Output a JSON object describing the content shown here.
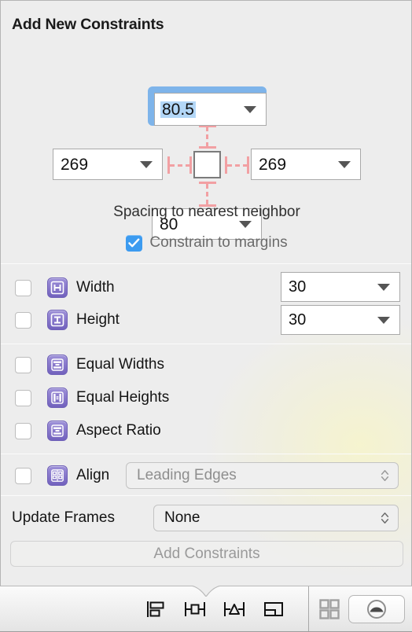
{
  "popover": {
    "title": "Add New Constraints",
    "spacing": {
      "top_value": "80.5",
      "left_value": "269",
      "right_value": "269",
      "bottom_value": "80",
      "caption": "Spacing to nearest neighbor",
      "constrain_margins_label": "Constrain to margins",
      "constrain_margins_checked": true,
      "connector_color": "#f2a0a3",
      "focus_ring_color": "#7eb4ea",
      "selection_color": "#b3d7f7"
    },
    "size_rows": [
      {
        "icon": "width-beam-icon",
        "label": "Width",
        "checked": false,
        "value": "30"
      },
      {
        "icon": "height-beam-icon",
        "label": "Height",
        "checked": false,
        "value": "30"
      }
    ],
    "relation_rows": [
      {
        "icon": "equal-widths-icon",
        "label": "Equal Widths",
        "checked": false
      },
      {
        "icon": "equal-heights-icon",
        "label": "Equal Heights",
        "checked": false
      },
      {
        "icon": "aspect-ratio-icon",
        "label": "Aspect Ratio",
        "checked": false
      }
    ],
    "align_row": {
      "icon": "align-icon",
      "label": "Align",
      "checked": false,
      "selected_option": "Leading Edges",
      "disabled": true
    },
    "update_frames": {
      "label": "Update Frames",
      "selected_option": "None"
    },
    "add_button": {
      "label": "Add Constraints",
      "disabled": true
    },
    "accent_color": "#3c9bf0",
    "icon_color": "#7f6fc6"
  },
  "bottom_bar": {
    "left_tools": [
      {
        "name": "align-tool-icon"
      },
      {
        "name": "pin-tool-icon"
      },
      {
        "name": "resolve-issues-tool-icon"
      },
      {
        "name": "stack-tool-icon"
      }
    ],
    "right_tools": [
      {
        "name": "grid-view-icon"
      },
      {
        "name": "preview-toggle-icon"
      }
    ]
  }
}
